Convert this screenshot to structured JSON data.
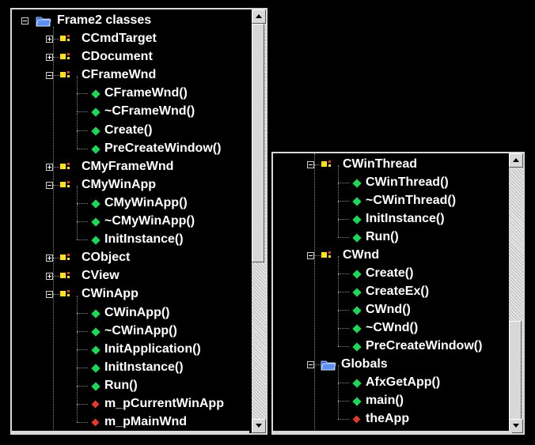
{
  "panel_left": {
    "root_label": "Frame2 classes",
    "rows": [
      {
        "label": "CCmdTarget",
        "kind": "class",
        "state": "collapsed"
      },
      {
        "label": "CDocument",
        "kind": "class",
        "state": "collapsed"
      },
      {
        "label": "CFrameWnd",
        "kind": "class",
        "state": "expanded"
      },
      {
        "label": "CFrameWnd()",
        "kind": "method"
      },
      {
        "label": "~CFrameWnd()",
        "kind": "method"
      },
      {
        "label": "Create()",
        "kind": "method"
      },
      {
        "label": "PreCreateWindow()",
        "kind": "method"
      },
      {
        "label": "CMyFrameWnd",
        "kind": "class",
        "state": "collapsed"
      },
      {
        "label": "CMyWinApp",
        "kind": "class",
        "state": "expanded"
      },
      {
        "label": "CMyWinApp()",
        "kind": "method"
      },
      {
        "label": "~CMyWinApp()",
        "kind": "method"
      },
      {
        "label": "InitInstance()",
        "kind": "method"
      },
      {
        "label": "CObject",
        "kind": "class",
        "state": "collapsed"
      },
      {
        "label": "CView",
        "kind": "class",
        "state": "collapsed"
      },
      {
        "label": "CWinApp",
        "kind": "class",
        "state": "expanded"
      },
      {
        "label": "CWinApp()",
        "kind": "method"
      },
      {
        "label": "~CWinApp()",
        "kind": "method"
      },
      {
        "label": "InitApplication()",
        "kind": "method"
      },
      {
        "label": "InitInstance()",
        "kind": "method"
      },
      {
        "label": "Run()",
        "kind": "method"
      },
      {
        "label": "m_pCurrentWinApp",
        "kind": "variable"
      },
      {
        "label": "m_pMainWnd",
        "kind": "variable"
      }
    ]
  },
  "panel_right": {
    "rows": [
      {
        "label": "CWinThread",
        "kind": "class",
        "state": "expanded"
      },
      {
        "label": "CWinThread()",
        "kind": "method"
      },
      {
        "label": "~CWinThread()",
        "kind": "method"
      },
      {
        "label": "InitInstance()",
        "kind": "method"
      },
      {
        "label": "Run()",
        "kind": "method"
      },
      {
        "label": "CWnd",
        "kind": "class",
        "state": "expanded"
      },
      {
        "label": "Create()",
        "kind": "method"
      },
      {
        "label": "CreateEx()",
        "kind": "method"
      },
      {
        "label": "CWnd()",
        "kind": "method"
      },
      {
        "label": "~CWnd()",
        "kind": "method"
      },
      {
        "label": "PreCreateWindow()",
        "kind": "method"
      },
      {
        "label": "Globals",
        "kind": "folder",
        "state": "expanded"
      },
      {
        "label": "AfxGetApp()",
        "kind": "method"
      },
      {
        "label": "main()",
        "kind": "method"
      },
      {
        "label": "theApp",
        "kind": "variable"
      }
    ]
  },
  "icons": {
    "class": "class-icon",
    "method": "method-icon",
    "variable": "member-variable-icon",
    "folder": "folder-icon",
    "expand": "expand-toggle-icon"
  },
  "colors": {
    "background": "#000000",
    "text": "#ffffff",
    "method_diamond": "#1ed65a",
    "variable_diamond": "#e23a2a",
    "class_yellow": "#ffe21a",
    "class_red": "#e23a2a",
    "folder": "#3a6fe0"
  }
}
